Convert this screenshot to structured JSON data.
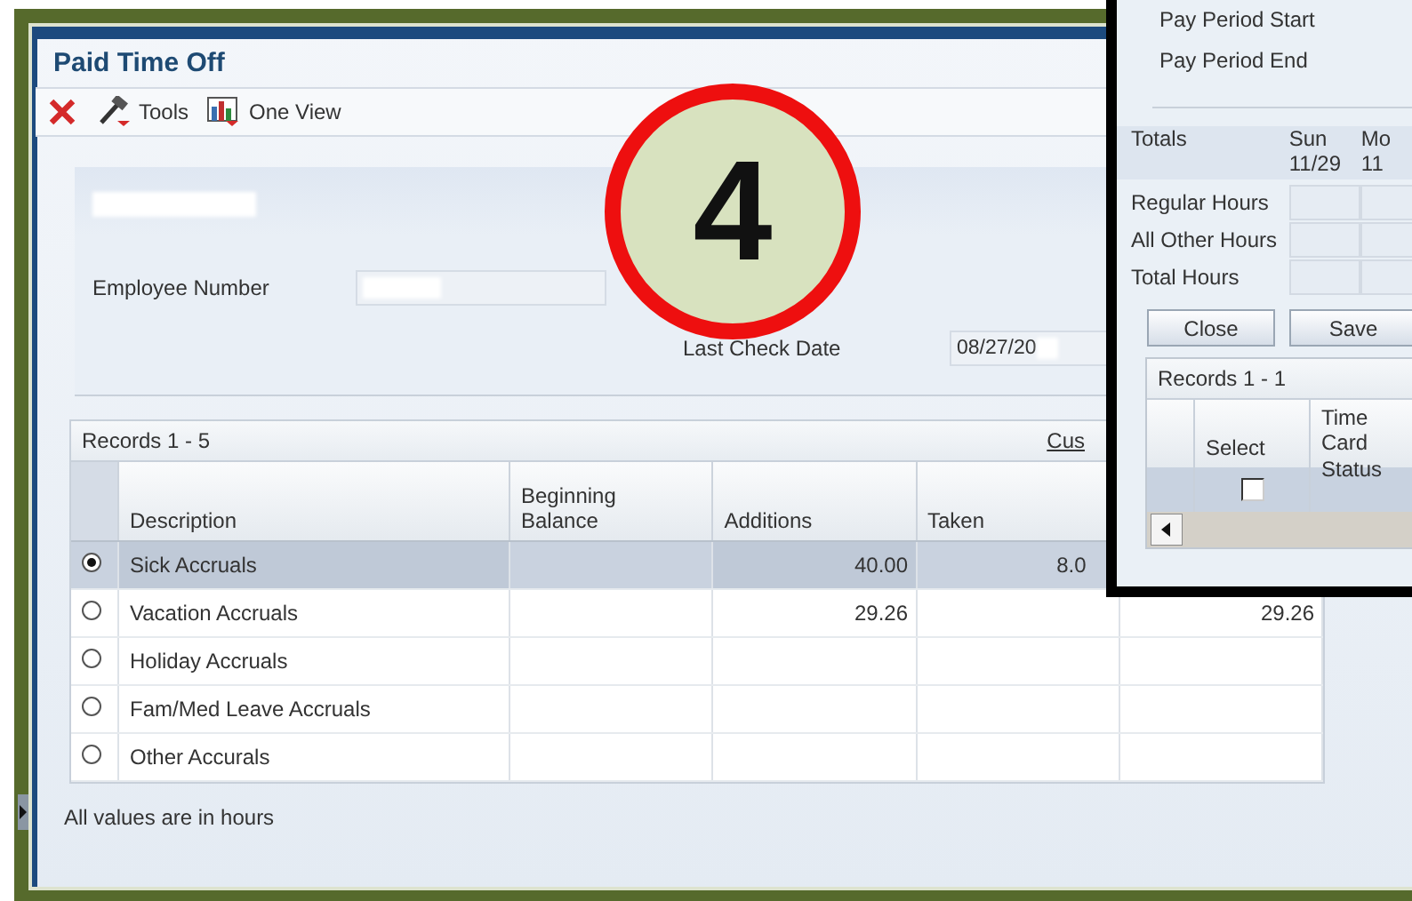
{
  "window": {
    "title": "Paid Time Off"
  },
  "toolbar": [
    {
      "kind": "delete"
    },
    {
      "kind": "tools",
      "label": "Tools"
    },
    {
      "kind": "one_view",
      "label": "One View"
    }
  ],
  "header": {
    "name_redacted": true,
    "fields": [
      {
        "label": "Employee Number",
        "redacted": true
      },
      {
        "label": "Last Check Date",
        "value": "08/27/20",
        "redacted": true
      }
    ]
  },
  "grid": {
    "records": "Records 1 - 5",
    "link": "Cus",
    "columns": [
      "Description",
      "Beginning Balance",
      "Additions",
      "Taken"
    ],
    "rows": [
      {
        "selected": true,
        "cells": [
          "Sick Accruals",
          null,
          "40.00",
          "8.0",
          null
        ]
      },
      {
        "selected": false,
        "cells": [
          "Vacation Accruals",
          null,
          "29.26",
          null,
          "29.26"
        ]
      },
      {
        "selected": false,
        "cells": [
          "Holiday Accruals",
          null,
          null,
          null,
          null
        ]
      },
      {
        "selected": false,
        "cells": [
          "Fam/Med Leave Accruals",
          null,
          null,
          null,
          null
        ]
      },
      {
        "selected": false,
        "cells": [
          "Other Accurals",
          null,
          null,
          null,
          null
        ]
      }
    ]
  },
  "footer": "All values are in hours",
  "step_badge": "4",
  "time_card_window": {
    "fields": [
      "Pay Period Start",
      "Pay Period End"
    ],
    "totals": {
      "label": "Totals",
      "days": [
        {
          "day": "Sun",
          "date": "11/29"
        },
        {
          "day": "Mo",
          "date": "11"
        }
      ],
      "rows": [
        "Regular Hours",
        "All Other Hours",
        "Total Hours"
      ]
    },
    "buttons": [
      "Close",
      "Save"
    ],
    "grid": {
      "records": "Records 1 - 1",
      "columns": [
        "Select",
        "Time Card Status"
      ],
      "rows": [
        {
          "checked": false
        }
      ]
    }
  }
}
